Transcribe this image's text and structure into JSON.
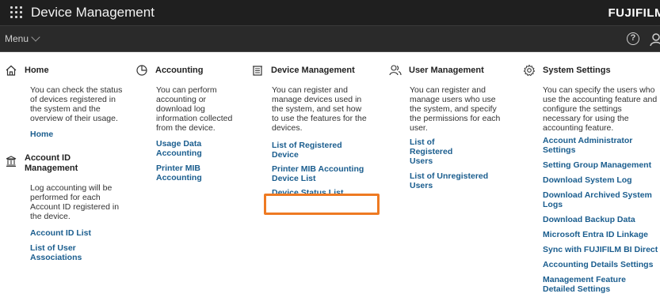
{
  "header": {
    "title": "Device Management",
    "brand": "FUJIFILM"
  },
  "menubar": {
    "menu_label": "Menu",
    "help_symbol": "?"
  },
  "columns": {
    "home": {
      "title": "Home",
      "desc": "You can check the status of devices registered in the system and the overview of their usage.",
      "links": [
        "Home"
      ]
    },
    "account_id": {
      "title": "Account ID Management",
      "desc": "Log accounting will be performed for each Account ID registered in the device.",
      "links": [
        "Account ID List",
        "List of User Associations"
      ]
    },
    "accounting": {
      "title": "Accounting",
      "desc": "You can perform accounting or download log information collected from the device.",
      "links": [
        "Usage Data Accounting",
        "Printer MIB Accounting"
      ]
    },
    "device_management": {
      "title": "Device Management",
      "desc": "You can register and manage devices used in the system, and set how to use the features for the devices.",
      "links": [
        "List of Registered Device",
        "Printer MIB Accounting Device List",
        "Device Status List"
      ]
    },
    "user_management": {
      "title": "User Management",
      "desc": "You can register and manage users who use the system, and specify the permissions for each user.",
      "links": [
        "List of Registered Users",
        "List of Unregistered Users"
      ]
    },
    "system_settings": {
      "title": "System Settings",
      "desc": "You can specify the users who use the accounting feature and configure the settings necessary for using the accounting feature.",
      "links": [
        "Account Administrator Settings",
        "Setting Group Management",
        "Download System Log",
        "Download Archived System Logs",
        "Download Backup Data",
        "Microsoft Entra ID Linkage",
        "Sync with FUJIFILM BI Direct",
        "Accounting Details Settings",
        "Management Feature Detailed Settings"
      ]
    }
  },
  "icons": {
    "apps": "grid-icon",
    "help": "help-icon",
    "user": "user-icon",
    "home": "home-icon",
    "account": "building-icon",
    "accounting": "pie-chart-icon",
    "device": "device-icon",
    "users": "users-icon",
    "settings": "gear-icon"
  },
  "colors": {
    "link": "#1a5d8e",
    "highlight": "#ee7a22",
    "topbar": "#1f1f1f"
  }
}
